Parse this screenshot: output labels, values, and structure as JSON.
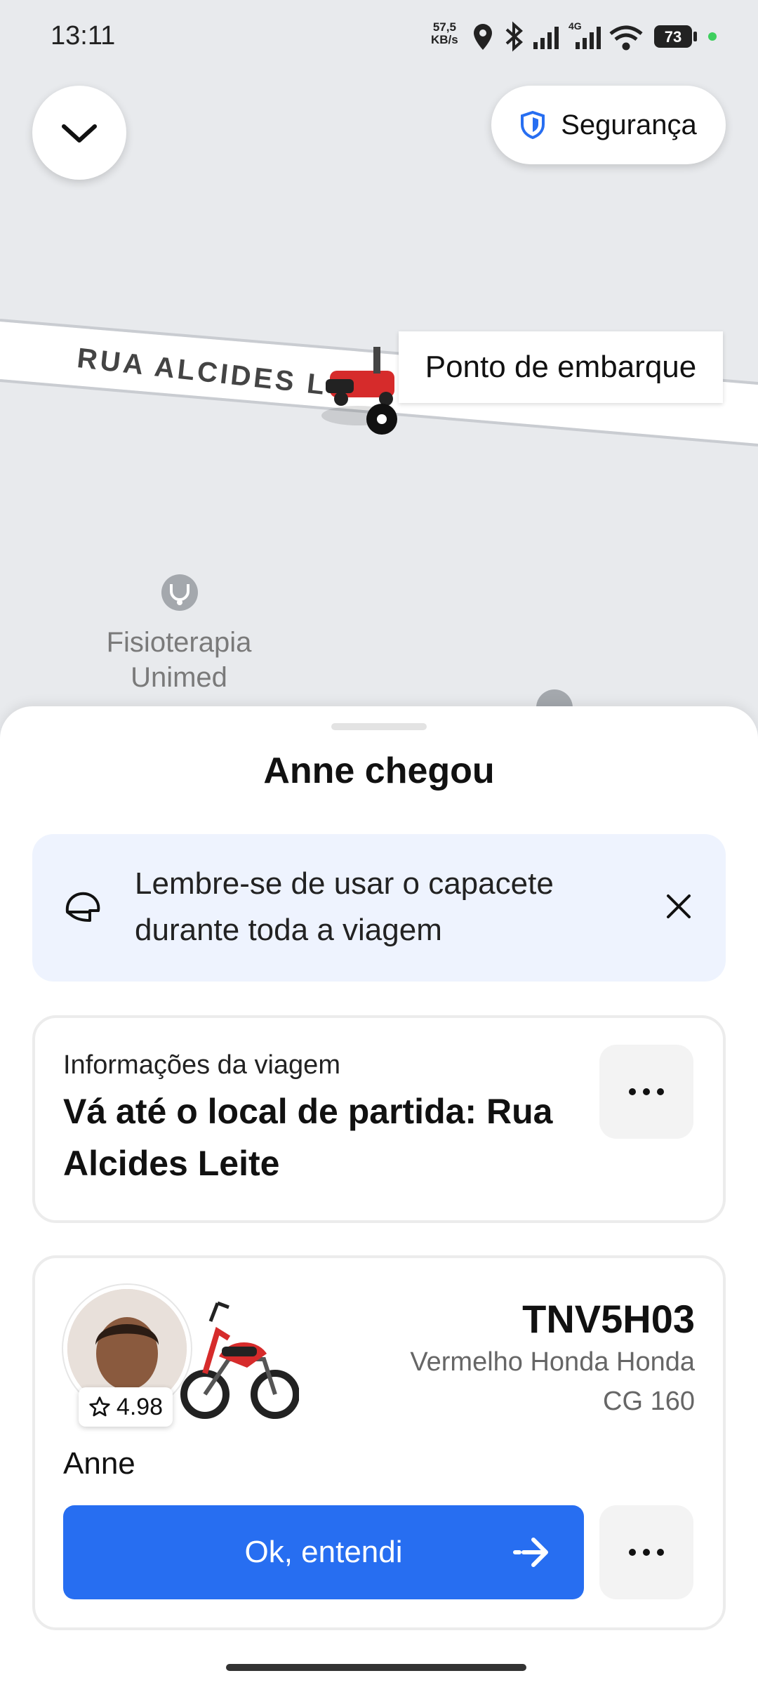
{
  "status_bar": {
    "time": "13:11",
    "net_speed_value": "57,5",
    "net_speed_unit": "KB/s",
    "network_type": "4G",
    "battery": "73"
  },
  "map": {
    "street_name": "RUA ALCIDES L",
    "pickup_label": "Ponto de embarque",
    "poi_name_line1": "Fisioterapia",
    "poi_name_line2": "Unimed"
  },
  "header": {
    "safety_label": "Segurança"
  },
  "sheet": {
    "title": "Anne chegou",
    "banner": {
      "text": "Lembre-se de usar o capacete durante toda a viagem"
    },
    "trip_info": {
      "subtitle": "Informações da viagem",
      "title": "Vá até o local de partida: Rua Alcides Leite"
    },
    "driver": {
      "name": "Anne",
      "rating": "4.98",
      "plate": "TNV5H03",
      "vehicle": "Vermelho Honda Honda CG 160"
    },
    "primary_button_label": "Ok, entendi"
  },
  "colors": {
    "accent": "#276ef1",
    "banner_bg": "#eef3fe",
    "map_bg": "#e8eaed"
  }
}
